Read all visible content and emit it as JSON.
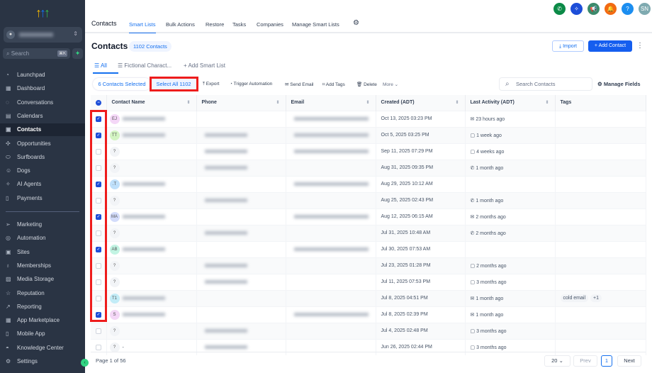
{
  "sidebar": {
    "account_icon": "user-icon",
    "search_placeholder": "Search",
    "search_shortcut": "⌘K",
    "items": [
      {
        "label": "Launchpad",
        "icon": "◔"
      },
      {
        "label": "Dashboard",
        "icon": "▦"
      },
      {
        "label": "Conversations",
        "icon": "◌"
      },
      {
        "label": "Calendars",
        "icon": "▤"
      },
      {
        "label": "Contacts",
        "icon": "▣"
      },
      {
        "label": "Opportunities",
        "icon": "✣"
      },
      {
        "label": "Surfboards",
        "icon": "⬭"
      },
      {
        "label": "Dogs",
        "icon": "☺"
      },
      {
        "label": "AI Agents",
        "icon": "✧"
      },
      {
        "label": "Payments",
        "icon": "▯"
      }
    ],
    "items2": [
      {
        "label": "Marketing",
        "icon": "➢"
      },
      {
        "label": "Automation",
        "icon": "◎"
      },
      {
        "label": "Sites",
        "icon": "▣"
      },
      {
        "label": "Memberships",
        "icon": "♁"
      },
      {
        "label": "Media Storage",
        "icon": "▨"
      },
      {
        "label": "Reputation",
        "icon": "☆"
      },
      {
        "label": "Reporting",
        "icon": "↗"
      },
      {
        "label": "App Marketplace",
        "icon": "▦"
      },
      {
        "label": "Mobile App",
        "icon": "▯"
      },
      {
        "label": "Knowledge Center",
        "icon": "◓"
      }
    ],
    "settings": "Settings"
  },
  "topnav": {
    "title": "Contacts",
    "tabs": [
      "Smart Lists",
      "Bulk Actions",
      "Restore",
      "Tasks",
      "Companies",
      "Manage Smart Lists"
    ],
    "avatar": "SN",
    "icon_colors": [
      "#0b8a47",
      "#1d4ed8",
      "#3c8a6b",
      "#f26a12",
      "#1c8ef0",
      "#7faab0"
    ]
  },
  "page": {
    "title": "Contacts",
    "count": "1102 Contacts",
    "import": "Import",
    "add": "Add Contact",
    "lists": [
      "All",
      "Fictional Charact...",
      "Add Smart List"
    ],
    "selected": "6 Contacts Selected",
    "select_all": "Select All 1102",
    "actions": [
      "Export",
      "Trigger Automation",
      "Send Email",
      "Add Tags",
      "Delete",
      "More"
    ],
    "search_placeholder": "Search Contacts",
    "manage_fields": "Manage Fields"
  },
  "table": {
    "columns": [
      "Contact Name",
      "Phone",
      "Email",
      "Created (ADT)",
      "Last Activity (ADT)",
      "Tags"
    ],
    "rows": [
      {
        "checked": true,
        "initials": "EJ",
        "color": "#f4d7f7",
        "name": true,
        "phone": false,
        "email": true,
        "created": "Oct 13, 2025 03:23 PM",
        "activity_icon": "✉",
        "activity": "23 hours ago",
        "tags": []
      },
      {
        "checked": true,
        "initials": "TT",
        "color": "#d3f4c2",
        "name": true,
        "phone": true,
        "email": true,
        "created": "Oct 5, 2025 03:25 PM",
        "activity_icon": "▢",
        "activity": "1 week ago",
        "tags": []
      },
      {
        "checked": false,
        "initials": "?",
        "color": "#f2f4f7",
        "name": false,
        "phone": true,
        "email": true,
        "created": "Sep 11, 2025 07:29 PM",
        "activity_icon": "▢",
        "activity": "4 weeks ago",
        "tags": []
      },
      {
        "checked": false,
        "initials": "?",
        "color": "#f2f4f7",
        "name": false,
        "phone": true,
        "email": false,
        "created": "Aug 31, 2025 09:35 PM",
        "activity_icon": "✆",
        "activity": "1 month ago",
        "tags": []
      },
      {
        "checked": true,
        "initials": ".T",
        "color": "#bfe0fb",
        "name": true,
        "phone": false,
        "email": true,
        "created": "Aug 29, 2025 10:12 AM",
        "activity_icon": "",
        "activity": "",
        "tags": []
      },
      {
        "checked": false,
        "initials": "?",
        "color": "#f2f4f7",
        "name": false,
        "phone": true,
        "email": false,
        "created": "Aug 25, 2025 02:43 PM",
        "activity_icon": "✆",
        "activity": "1 month ago",
        "tags": []
      },
      {
        "checked": true,
        "initials": "MA",
        "color": "#d3dcfb",
        "name": true,
        "phone": false,
        "email": true,
        "created": "Aug 12, 2025 06:15 AM",
        "activity_icon": "✉",
        "activity": "2 months ago",
        "tags": []
      },
      {
        "checked": false,
        "initials": "?",
        "color": "#f2f4f7",
        "name": false,
        "phone": true,
        "email": false,
        "created": "Jul 31, 2025 10:48 AM",
        "activity_icon": "✆",
        "activity": "2 months ago",
        "tags": []
      },
      {
        "checked": true,
        "initials": "AB",
        "color": "#c2f4e3",
        "name": true,
        "phone": false,
        "email": true,
        "created": "Jul 30, 2025 07:53 AM",
        "activity_icon": "",
        "activity": "",
        "tags": []
      },
      {
        "checked": false,
        "initials": "?",
        "color": "#f2f4f7",
        "name": false,
        "phone": true,
        "email": false,
        "created": "Jul 23, 2025 01:28 PM",
        "activity_icon": "▢",
        "activity": "2 months ago",
        "tags": []
      },
      {
        "checked": false,
        "initials": "?",
        "color": "#f2f4f7",
        "name": false,
        "phone": true,
        "email": false,
        "created": "Jul 11, 2025 07:53 PM",
        "activity_icon": "▢",
        "activity": "3 months ago",
        "tags": []
      },
      {
        "checked": false,
        "initials": "T1",
        "color": "#c2ecf7",
        "name": true,
        "phone": false,
        "email": false,
        "created": "Jul 8, 2025 04:51 PM",
        "activity_icon": "✉",
        "activity": "1 month ago",
        "tags": [
          "cold email",
          "+1"
        ]
      },
      {
        "checked": true,
        "initials": "S",
        "color": "#f4d7f7",
        "name": true,
        "phone": false,
        "email": true,
        "created": "Jul 8, 2025 02:39 PM",
        "activity_icon": "✉",
        "activity": "1 month ago",
        "tags": []
      },
      {
        "checked": false,
        "initials": "?",
        "color": "#f2f4f7",
        "name": false,
        "phone": true,
        "email": false,
        "created": "Jul 4, 2025 02:48 PM",
        "activity_icon": "▢",
        "activity": "3 months ago",
        "tags": []
      },
      {
        "checked": false,
        "initials": "?",
        "color": "#f2f4f7",
        "name": false,
        "name_text": "-",
        "phone": true,
        "email": false,
        "created": "Jun 26, 2025 02:44 PM",
        "activity_icon": "▢",
        "activity": "3 months ago",
        "tags": []
      }
    ]
  },
  "footer": {
    "page_info": "Page 1 of 56",
    "per_page": "20",
    "prev": "Prev",
    "current": "1",
    "next": "Next"
  }
}
